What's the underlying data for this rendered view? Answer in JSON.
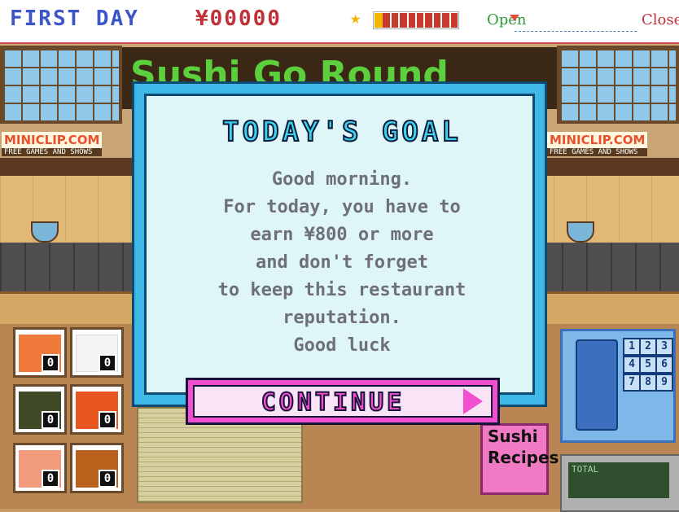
{
  "hud": {
    "day": "FIRST DAY",
    "money": "¥00000",
    "reputation_fraction": 0.1,
    "open_label": "Open",
    "close_label": "Close",
    "icons": [
      "star-icon",
      "cup-icon"
    ]
  },
  "scene": {
    "sign_text": "Sushi Go Round",
    "brand_left": "MINICLIP.COM",
    "brand_right": "MINICLIP.COM",
    "brand_sub": "FREE GAMES AND SHOWS"
  },
  "ingredients": [
    {
      "name": "shrimp",
      "count": "0",
      "color": "#f07a3c"
    },
    {
      "name": "rice",
      "count": "0",
      "color": "#f4f4f4"
    },
    {
      "name": "nori",
      "count": "0",
      "color": "#3e4a25"
    },
    {
      "name": "roe",
      "count": "0",
      "color": "#e8551f"
    },
    {
      "name": "salmon",
      "count": "0",
      "color": "#f29a7c"
    },
    {
      "name": "unagi",
      "count": "0",
      "color": "#b8601c"
    }
  ],
  "phone": {
    "keys": [
      "1",
      "2",
      "3",
      "4",
      "5",
      "6",
      "7",
      "8",
      "9"
    ]
  },
  "register": {
    "total_label": "TOTAL"
  },
  "recipes": {
    "line1": "Sushi",
    "line2": "Recipes"
  },
  "modal": {
    "title": "TODAY'S GOAL",
    "lines": [
      "Good morning.",
      "For today, you have to",
      "earn ¥800  or more",
      "and don't forget",
      "to keep this restaurant",
      "reputation.",
      "Good luck"
    ],
    "button_label": "CONTINUE"
  }
}
